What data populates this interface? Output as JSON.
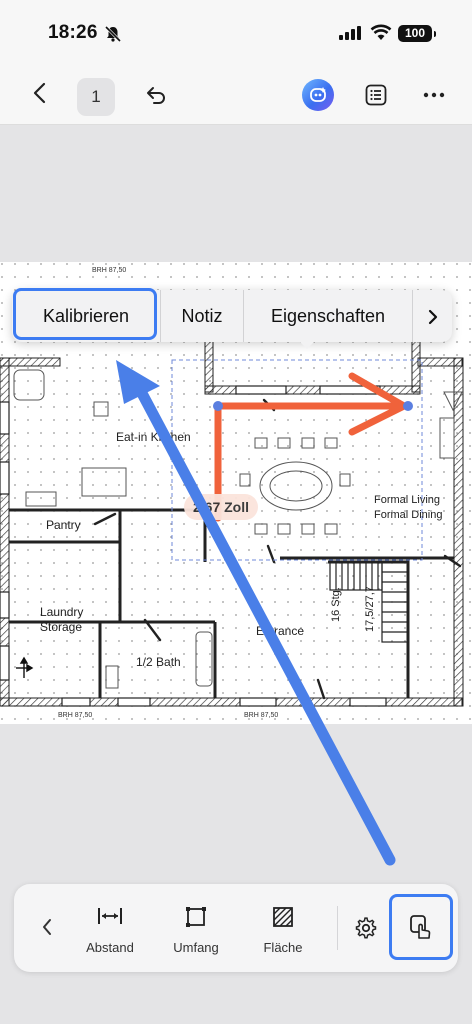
{
  "status": {
    "time": "18:26",
    "battery": "100"
  },
  "toolbar": {
    "page_number": "1"
  },
  "context_menu": {
    "items": [
      "Kalibrieren",
      "Notiz",
      "Eigenschaften"
    ]
  },
  "measurement": {
    "label": "2 67 Zoll"
  },
  "floorplan": {
    "rooms": [
      "Eat-in Kitchen",
      "Pantry",
      "Laundry",
      "Storage",
      "1/2 Bath",
      "Entrance",
      "Formal Living",
      "Formal Dining",
      "16 Stg.",
      "17,5/27,7"
    ],
    "markers": [
      "BRH 87,50",
      "BRH 87,50",
      "BRH 87,50"
    ]
  },
  "bottom_tools": {
    "distance": "Abstand",
    "perimeter": "Umfang",
    "area": "Fläche"
  },
  "colors": {
    "highlight": "#3d7cf2",
    "measure": "#f0623b",
    "arrow": "#4a7fe8"
  }
}
